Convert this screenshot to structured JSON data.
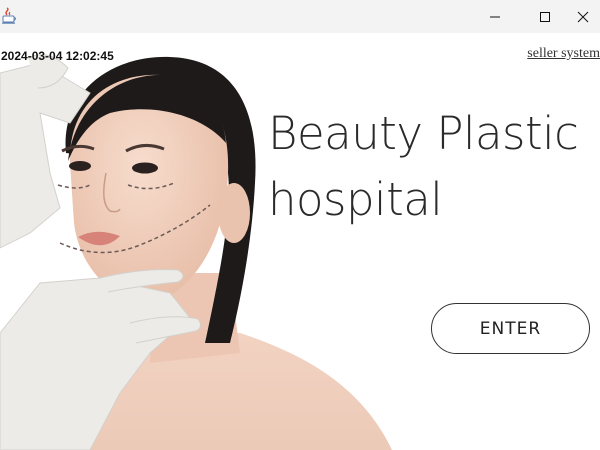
{
  "titlebar": {
    "icons": {
      "app": "java-app-icon",
      "minimize": "minimize-icon",
      "maximize": "maximize-icon",
      "close": "close-icon"
    }
  },
  "header": {
    "datetime": "2024-03-04 12:02:45",
    "seller_link": "seller system"
  },
  "hero": {
    "headline_line1": "Beauty Plastic",
    "headline_line2": "hospital",
    "enter_label": "ENTER"
  },
  "colors": {
    "titlebar_bg": "#f3f3f3",
    "text": "#2a2a2a",
    "button_border": "#333333"
  }
}
